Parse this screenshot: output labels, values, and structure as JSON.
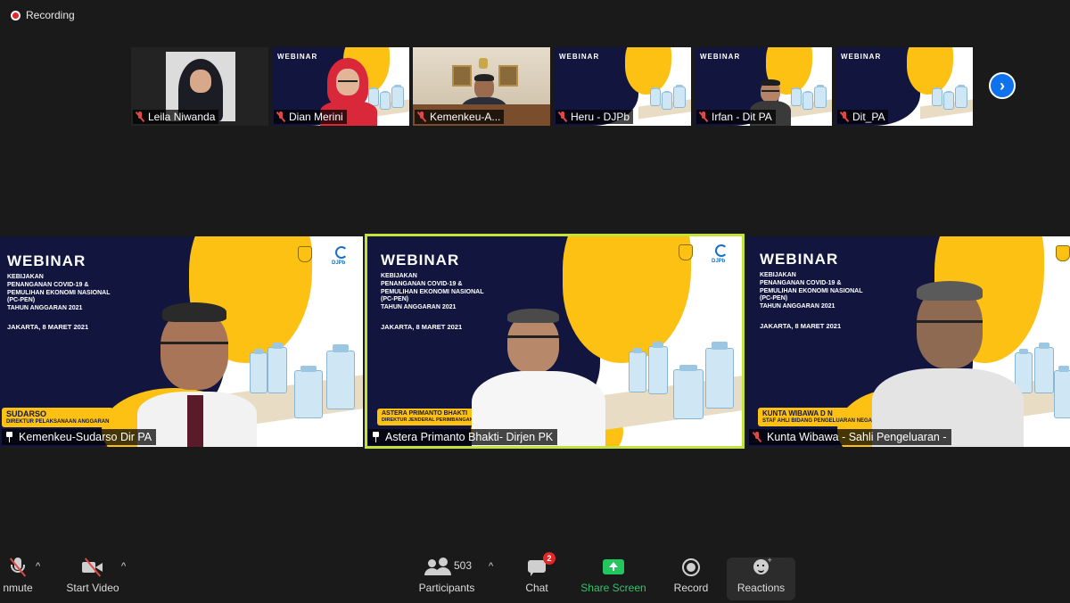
{
  "recording": {
    "label": "Recording"
  },
  "thumbnails": [
    {
      "name": "Leila Niwanda"
    },
    {
      "name": "Dian Merini"
    },
    {
      "name": "Kemenkeu-A..."
    },
    {
      "name": "Heru - DJPb"
    },
    {
      "name": "Irfan - Dit PA"
    },
    {
      "name": "Dit_PA"
    }
  ],
  "slide": {
    "title": "WEBINAR",
    "subtitle_lines": [
      "KEBIJAKAN",
      "PENANGANAN COVID-19 &",
      "PEMULIHAN EKONOMI NASIONAL",
      "(PC-PEN)",
      "TAHUN ANGGARAN 2021"
    ],
    "date": "JAKARTA, 8 MARET 2021",
    "logo_text": "DJPb"
  },
  "main_tiles": [
    {
      "name": "Kemenkeu-Sudarso Dir PA",
      "plate_name": "SUDARSO",
      "plate_role": "DIREKTUR PELAKSANAAN ANGGARAN"
    },
    {
      "name": "Astera Primanto Bhakti- Dirjen PK",
      "plate_name": "ASTERA PRIMANTO BHAKTI",
      "plate_role": "DIREKTUR JENDERAL PERIMBANGAN KEUANGAN"
    },
    {
      "name": "Kunta Wibawa - Sahli Pengeluaran -",
      "plate_name": "KUNTA WIBAWA D N",
      "plate_role": "STAF AHLI BIDANG PENGELUARAN NEGARA"
    }
  ],
  "toolbar": {
    "unmute": "nmute",
    "start_video": "Start Video",
    "participants": "Participants",
    "participants_count": "503",
    "chat": "Chat",
    "chat_badge": "2",
    "share_screen": "Share Screen",
    "record": "Record",
    "reactions": "Reactions"
  },
  "colors": {
    "accent": "#0e72ed",
    "active_speaker": "#c4e33a",
    "share": "#33c26b",
    "alert": "#e02828",
    "slide_yellow": "#fdc113",
    "slide_navy": "#12163f"
  }
}
